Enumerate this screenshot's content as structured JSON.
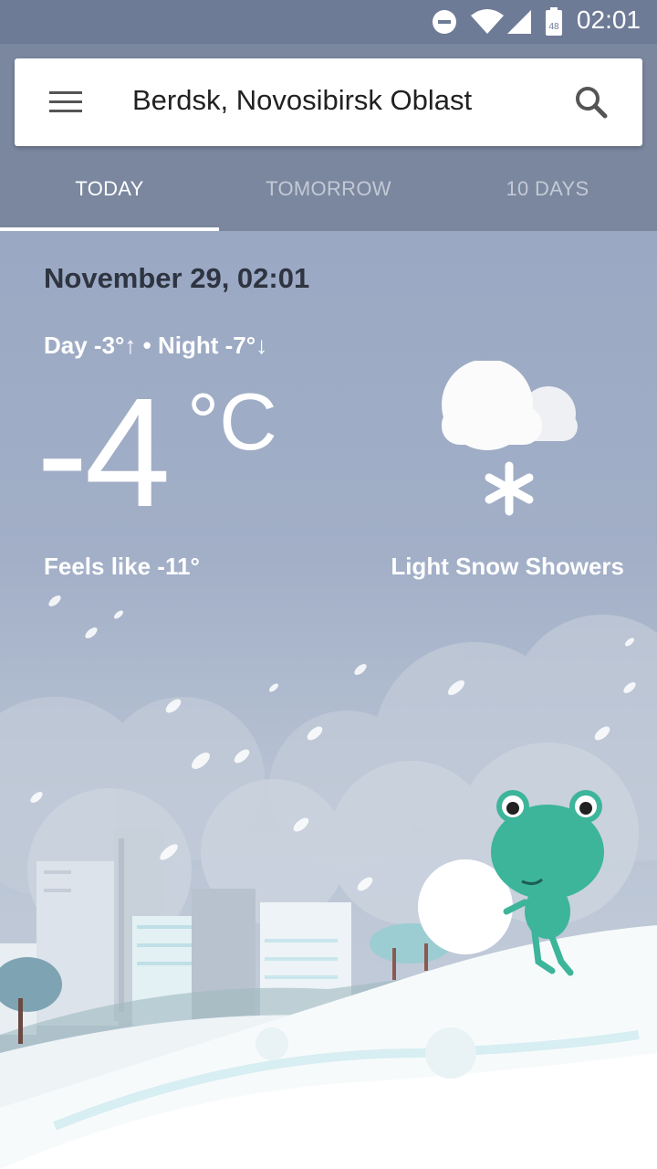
{
  "status_bar": {
    "time": "02:01",
    "icons": [
      "do-not-disturb-icon",
      "wifi-icon",
      "signal-icon",
      "battery-icon"
    ],
    "battery_label": "48"
  },
  "header": {
    "location": "Berdsk, Novosibirsk Oblast",
    "menu_icon": "menu-icon",
    "search_icon": "search-icon"
  },
  "tabs": [
    {
      "label": "TODAY",
      "active": true
    },
    {
      "label": "TOMORROW",
      "active": false
    },
    {
      "label": "10 DAYS",
      "active": false
    }
  ],
  "weather": {
    "date": "November 29, 02:01",
    "day_night": "Day -3°↑ • Night -7°↓",
    "temperature": "-4",
    "unit": "°C",
    "feels_like": "Feels like -11°",
    "condition": "Light Snow Showers",
    "condition_icon": "snow-cloud-icon"
  },
  "colors": {
    "status_bar": "#6e7b96",
    "header": "#7a879f",
    "accent": "#ffffff",
    "sky_top": "#9aa8c3",
    "frog": "#3db59a"
  }
}
